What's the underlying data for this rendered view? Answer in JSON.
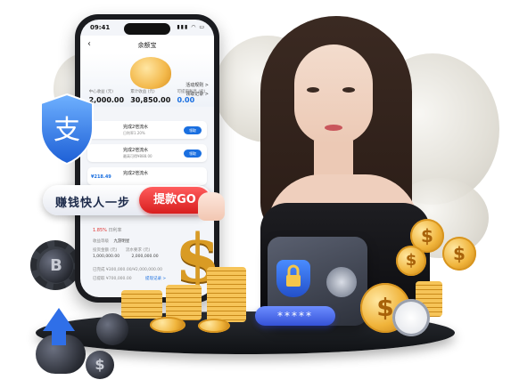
{
  "phone": {
    "time": "09:41",
    "title": "余额宝",
    "hero_links": [
      "活动规则 >",
      "领取记录 >"
    ],
    "stats": [
      {
        "label": "中心收益 (元)",
        "value": "2,000.00"
      },
      {
        "label": "累计收益 (元)",
        "value": "30,850.00"
      },
      {
        "label": "可提取利息 (元)",
        "value": "0.00"
      }
    ],
    "cards": [
      {
        "title": "完成2倍流水",
        "sub": "日利率1.20%",
        "button": "领取",
        "amount": ""
      },
      {
        "title": "完成2倍流水",
        "sub": "最高可得¥888.00",
        "button": "领取",
        "amount": ""
      },
      {
        "title": "完成2倍流水",
        "sub": "",
        "button": "",
        "amount": "¥218.49"
      }
    ],
    "rate_value": "1.85%",
    "rate_label": "日利率",
    "details": [
      {
        "left": "收益等级",
        "right": "九游明星"
      },
      {
        "left": "投资金额 (元)",
        "right": "流水要求 (元)"
      },
      {
        "left": "1,000,000.00",
        "right": "2,000,000.00"
      },
      {
        "left": "已完成 ¥300,000.00/¥2,000,000.00",
        "right": ""
      },
      {
        "left": "已提取 ¥700,000.00",
        "right": "提现记录 >"
      }
    ]
  },
  "banner": {
    "text": "赚钱快人一步",
    "button": "提款GO"
  },
  "password_mask": "*****",
  "icons": {
    "shield": "alipay-shield-icon",
    "lock": "padlock-icon",
    "safe": "vault-icon",
    "clock": "stopwatch-icon",
    "arrow": "arrow-up-icon"
  },
  "colors": {
    "accent_blue": "#1a6fe0",
    "go_red": "#e0312f",
    "gold": "#f0b43b"
  },
  "coin_symbols": {
    "dollar": "$",
    "bitcoin": "B"
  }
}
